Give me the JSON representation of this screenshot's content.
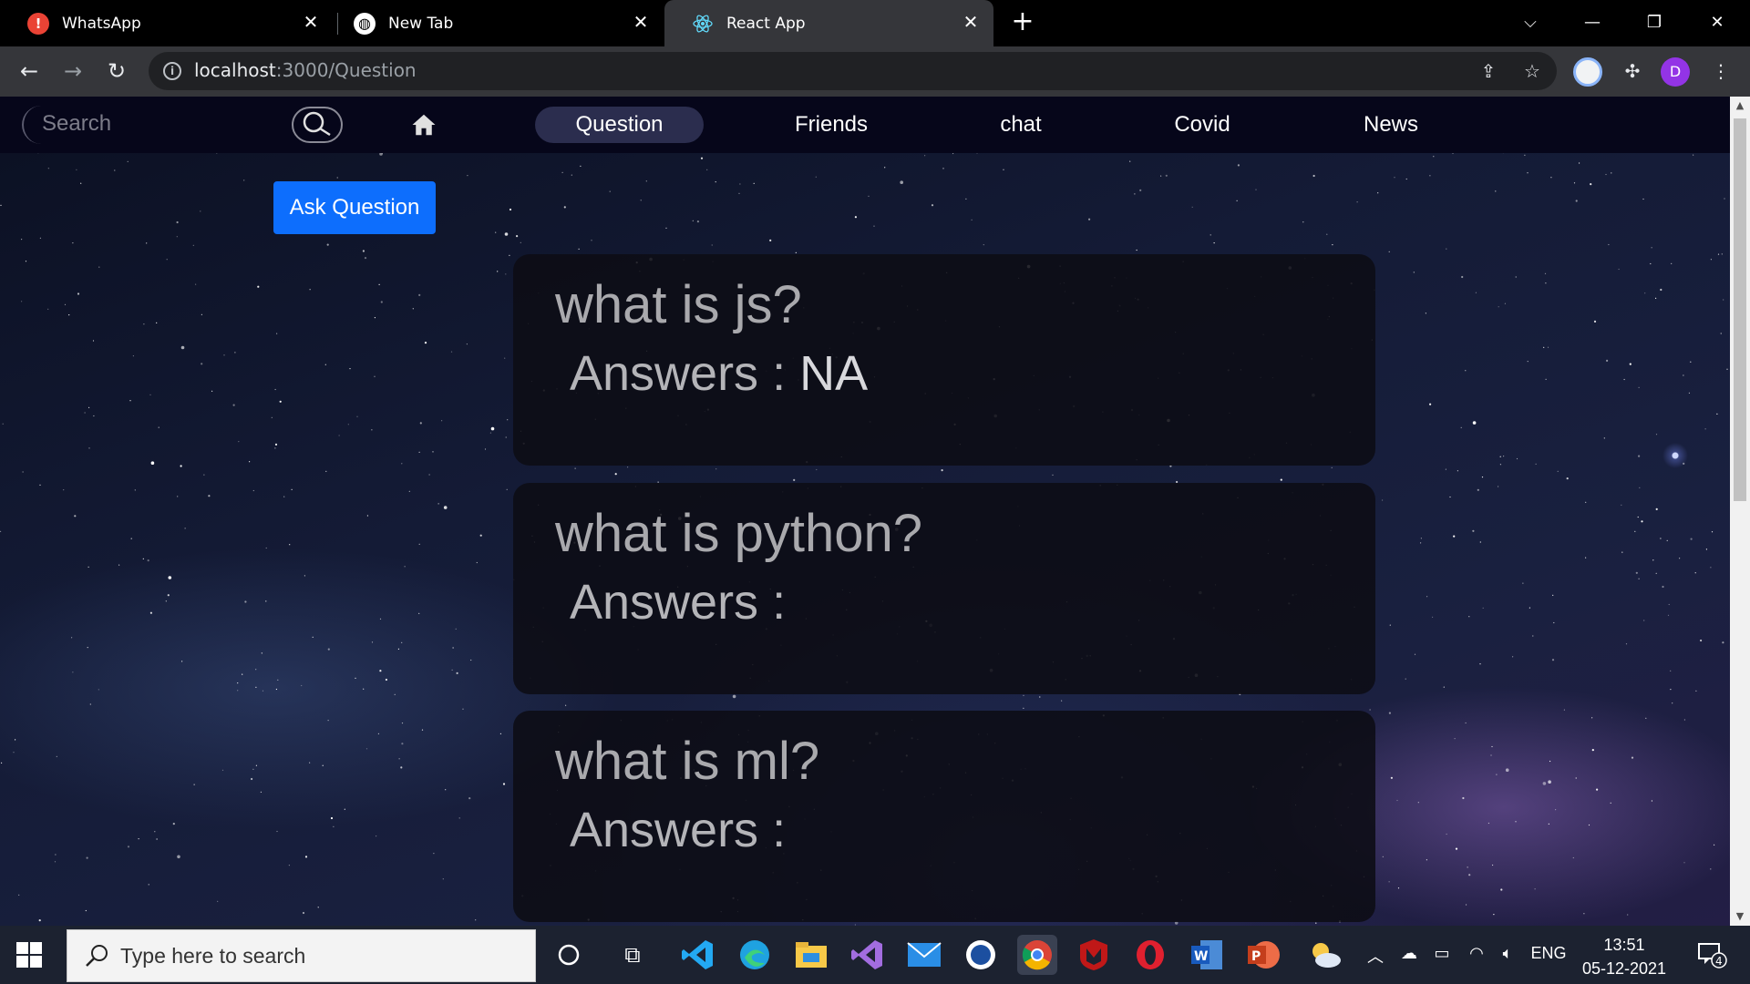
{
  "browser": {
    "tabs": [
      {
        "title": "WhatsApp",
        "icon": "whatsapp-alert-icon"
      },
      {
        "title": "New Tab",
        "icon": "globe-icon"
      },
      {
        "title": "React App",
        "icon": "react-icon",
        "active": true
      }
    ],
    "url_host": "localhost",
    "url_path": ":3000/Question",
    "profile_initial": "D"
  },
  "site": {
    "search_placeholder": "Search",
    "nav": [
      "Question",
      "Friends",
      "chat",
      "Covid",
      "News"
    ],
    "active_nav": "Question",
    "ask_button": "Ask Question",
    "questions": [
      {
        "title": "what is js?",
        "answer_label": "Answers :",
        "answer_value": "NA"
      },
      {
        "title": "what is python?",
        "answer_label": "Answers :",
        "answer_value": ""
      },
      {
        "title": "what is ml?",
        "answer_label": "Answers :",
        "answer_value": ""
      }
    ]
  },
  "taskbar": {
    "search_placeholder": "Type here to search",
    "language": "ENG",
    "time": "13:51",
    "date": "05-12-2021",
    "notification_count": "4"
  },
  "colors": {
    "accent_button": "#0d6efd",
    "nav_background": "#06061a",
    "card_background": "#0c0c14",
    "active_nav_pill": "#2b2d4e"
  }
}
